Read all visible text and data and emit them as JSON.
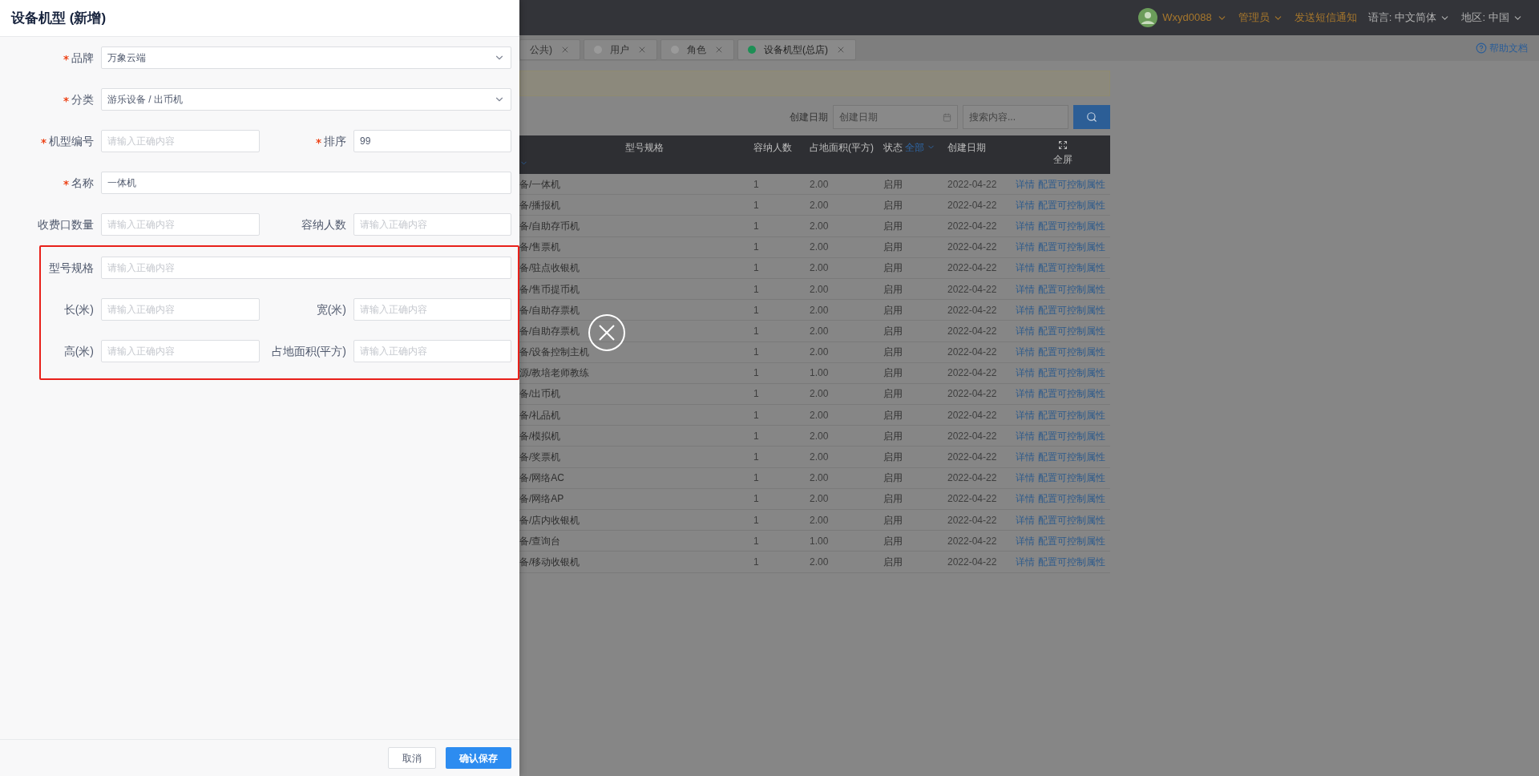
{
  "topbar": {
    "user": "Wxyd0088",
    "role": "管理员",
    "sms_link": "发送短信通知",
    "language": {
      "label": "语言:",
      "value": "中文简体"
    },
    "region": {
      "label": "地区:",
      "value": "中国"
    }
  },
  "tabs": [
    {
      "label": "公共)",
      "selected": false
    },
    {
      "label": "用户",
      "selected": false
    },
    {
      "label": "角色",
      "selected": false
    },
    {
      "label": "设备机型(总店)",
      "selected": true
    }
  ],
  "help_link": "帮助文档",
  "filter": {
    "date_label": "创建日期",
    "date_placeholder": "创建日期",
    "search_placeholder": "搜索内容..."
  },
  "table": {
    "columns": [
      "型号规格",
      "容纳人数",
      "占地面积(平方)",
      "状态",
      "创建日期",
      "全屏"
    ],
    "status_filter": "全部",
    "rows": [
      {
        "column_1": "备/一体机",
        "capacity": "1",
        "area": "2.00",
        "status": "启用",
        "date": "2022-04-22",
        "actions": [
          "详情",
          "配置可控制属性"
        ]
      },
      {
        "column_1": "备/播报机",
        "capacity": "1",
        "area": "2.00",
        "status": "启用",
        "date": "2022-04-22",
        "actions": [
          "详情",
          "配置可控制属性"
        ]
      },
      {
        "column_1": "备/自助存币机",
        "capacity": "1",
        "area": "2.00",
        "status": "启用",
        "date": "2022-04-22",
        "actions": [
          "详情",
          "配置可控制属性"
        ]
      },
      {
        "column_1": "备/售票机",
        "capacity": "1",
        "area": "2.00",
        "status": "启用",
        "date": "2022-04-22",
        "actions": [
          "详情",
          "配置可控制属性"
        ]
      },
      {
        "column_1": "备/驻点收银机",
        "capacity": "1",
        "area": "2.00",
        "status": "启用",
        "date": "2022-04-22",
        "actions": [
          "详情",
          "配置可控制属性"
        ]
      },
      {
        "column_1": "备/售币提币机",
        "capacity": "1",
        "area": "2.00",
        "status": "启用",
        "date": "2022-04-22",
        "actions": [
          "详情",
          "配置可控制属性"
        ]
      },
      {
        "column_1": "备/自助存票机",
        "capacity": "1",
        "area": "2.00",
        "status": "启用",
        "date": "2022-04-22",
        "actions": [
          "详情",
          "配置可控制属性"
        ]
      },
      {
        "column_1": "备/自助存票机",
        "capacity": "1",
        "area": "2.00",
        "status": "启用",
        "date": "2022-04-22",
        "actions": [
          "详情",
          "配置可控制属性"
        ]
      },
      {
        "column_1": "备/设备控制主机",
        "capacity": "1",
        "area": "2.00",
        "status": "启用",
        "date": "2022-04-22",
        "actions": [
          "详情",
          "配置可控制属性"
        ]
      },
      {
        "column_1": "源/教培老师教练",
        "capacity": "1",
        "area": "1.00",
        "status": "启用",
        "date": "2022-04-22",
        "actions": [
          "详情",
          "配置可控制属性"
        ]
      },
      {
        "column_1": "备/出币机",
        "capacity": "1",
        "area": "2.00",
        "status": "启用",
        "date": "2022-04-22",
        "actions": [
          "详情",
          "配置可控制属性"
        ]
      },
      {
        "column_1": "备/礼品机",
        "capacity": "1",
        "area": "2.00",
        "status": "启用",
        "date": "2022-04-22",
        "actions": [
          "详情",
          "配置可控制属性"
        ]
      },
      {
        "column_1": "备/模拟机",
        "capacity": "1",
        "area": "2.00",
        "status": "启用",
        "date": "2022-04-22",
        "actions": [
          "详情",
          "配置可控制属性"
        ]
      },
      {
        "column_1": "备/奖票机",
        "capacity": "1",
        "area": "2.00",
        "status": "启用",
        "date": "2022-04-22",
        "actions": [
          "详情",
          "配置可控制属性"
        ]
      },
      {
        "column_1": "备/网络AC",
        "capacity": "1",
        "area": "2.00",
        "status": "启用",
        "date": "2022-04-22",
        "actions": [
          "详情",
          "配置可控制属性"
        ]
      },
      {
        "column_1": "备/网络AP",
        "capacity": "1",
        "area": "2.00",
        "status": "启用",
        "date": "2022-04-22",
        "actions": [
          "详情",
          "配置可控制属性"
        ]
      },
      {
        "column_1": "备/店内收银机",
        "capacity": "1",
        "area": "2.00",
        "status": "启用",
        "date": "2022-04-22",
        "actions": [
          "详情",
          "配置可控制属性"
        ]
      },
      {
        "column_1": "备/查询台",
        "capacity": "1",
        "area": "1.00",
        "status": "启用",
        "date": "2022-04-22",
        "actions": [
          "详情",
          "配置可控制属性"
        ]
      },
      {
        "column_1": "备/移动收银机",
        "capacity": "1",
        "area": "2.00",
        "status": "启用",
        "date": "2022-04-22",
        "actions": [
          "详情",
          "配置可控制属性"
        ]
      }
    ]
  },
  "drawer": {
    "title": "设备机型 (新增)",
    "sections": [
      {
        "highlighted": false,
        "rows": [
          {
            "fields": [
              {
                "label": "品牌",
                "required": true,
                "kind": "select",
                "value": "万象云端"
              }
            ]
          },
          {
            "fields": [
              {
                "label": "分类",
                "required": true,
                "kind": "select",
                "value": "游乐设备 / 出币机"
              }
            ]
          },
          {
            "fields": [
              {
                "label": "机型编号",
                "required": true,
                "kind": "input",
                "placeholder": "请输入正确内容"
              },
              {
                "label": "排序",
                "required": true,
                "kind": "input",
                "value": "99"
              }
            ]
          },
          {
            "fields": [
              {
                "label": "名称",
                "required": true,
                "kind": "input",
                "value": "一体机"
              }
            ]
          },
          {
            "fields": [
              {
                "label": "收费口数量",
                "required": false,
                "kind": "input",
                "placeholder": "请输入正确内容"
              },
              {
                "label": "容纳人数",
                "required": false,
                "kind": "input",
                "placeholder": "请输入正确内容"
              }
            ]
          }
        ]
      },
      {
        "highlighted": true,
        "rows": [
          {
            "fields": [
              {
                "label": "型号规格",
                "required": false,
                "kind": "input",
                "placeholder": "请输入正确内容"
              }
            ]
          },
          {
            "fields": [
              {
                "label": "长(米)",
                "required": false,
                "kind": "input",
                "placeholder": "请输入正确内容"
              },
              {
                "label": "宽(米)",
                "required": false,
                "kind": "input",
                "placeholder": "请输入正确内容"
              }
            ]
          },
          {
            "fields": [
              {
                "label": "高(米)",
                "required": false,
                "kind": "input",
                "placeholder": "请输入正确内容"
              },
              {
                "label": "占地面积(平方)",
                "required": false,
                "kind": "input",
                "placeholder": "请输入正确内容"
              }
            ]
          }
        ]
      }
    ],
    "buttons": [
      {
        "label": "取消",
        "kind": "secondary"
      },
      {
        "label": "确认保存",
        "kind": "primary"
      }
    ]
  }
}
